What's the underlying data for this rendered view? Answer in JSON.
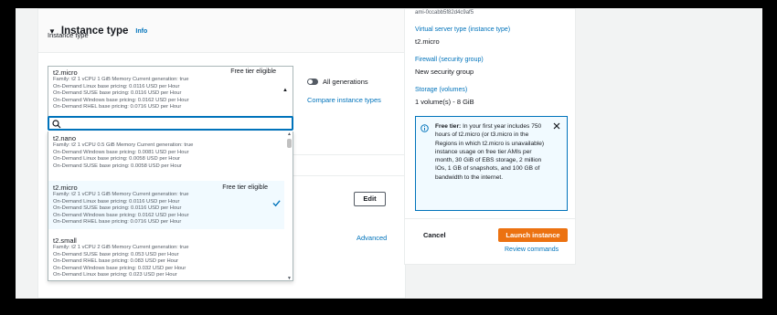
{
  "section": {
    "title": "Instance type",
    "info": "Info",
    "field_label": "Instance type"
  },
  "selected": {
    "name": "t2.micro",
    "free_tier": "Free tier eligible",
    "meta": [
      "Family: t2    1 vCPU    1 GiB Memory    Current generation: true",
      "On-Demand Linux base pricing: 0.0116 USD per Hour",
      "On-Demand SUSE base pricing: 0.0116 USD per Hour",
      "On-Demand Windows base pricing: 0.0162 USD per Hour",
      "On-Demand RHEL base pricing: 0.0716 USD per Hour"
    ]
  },
  "search": {
    "placeholder": ""
  },
  "options": [
    {
      "name": "t2.nano",
      "free_tier": "",
      "meta": [
        "Family: t2    1 vCPU    0.5 GiB Memory    Current generation: true",
        "On-Demand Windows base pricing: 0.0081 USD per Hour",
        "On-Demand Linux base pricing: 0.0058 USD per Hour",
        "On-Demand SUSE base pricing: 0.0058 USD per Hour"
      ]
    },
    {
      "name": "t2.micro",
      "free_tier": "Free tier eligible",
      "meta": [
        "Family: t2    1 vCPU    1 GiB Memory    Current generation: true",
        "On-Demand Linux base pricing: 0.0116 USD per Hour",
        "On-Demand SUSE base pricing: 0.0116 USD per Hour",
        "On-Demand Windows base pricing: 0.0162 USD per Hour",
        "On-Demand RHEL base pricing: 0.0716 USD per Hour"
      ]
    },
    {
      "name": "t2.small",
      "free_tier": "",
      "meta": [
        "Family: t2    1 vCPU    2 GiB Memory    Current generation: true",
        "On-Demand SUSE base pricing: 0.053 USD per Hour",
        "On-Demand RHEL base pricing: 0.083 USD per Hour",
        "On-Demand Windows base pricing: 0.032 USD per Hour",
        "On-Demand Linux base pricing: 0.023 USD per Hour"
      ]
    }
  ],
  "toggle_label": "All generations",
  "compare_link": "Compare instance types",
  "edit_button": "Edit",
  "advanced_link": "Advanced",
  "summary": {
    "ami_id": "ami-0ccabb5f82d4c9af5",
    "server_type_label": "Virtual server type (instance type)",
    "server_type_value": "t2.micro",
    "firewall_label": "Firewall (security group)",
    "firewall_value": "New security group",
    "storage_label": "Storage (volumes)",
    "storage_value": "1 volume(s) - 8 GiB",
    "free_tier_heading": "Free tier:",
    "free_tier_text": "In your first year includes 750 hours of t2.micro (or t3.micro in the Regions in which t2.micro is unavailable) instance usage on free tier AMIs per month, 30 GiB of EBS storage, 2 million IOs, 1 GB of snapshots, and 100 GB of bandwidth to the internet.",
    "cancel": "Cancel",
    "launch": "Launch instance",
    "review": "Review commands"
  },
  "colors": {
    "link": "#0073bb",
    "primary_button": "#ec7211",
    "alert_bg": "#f1faff"
  }
}
